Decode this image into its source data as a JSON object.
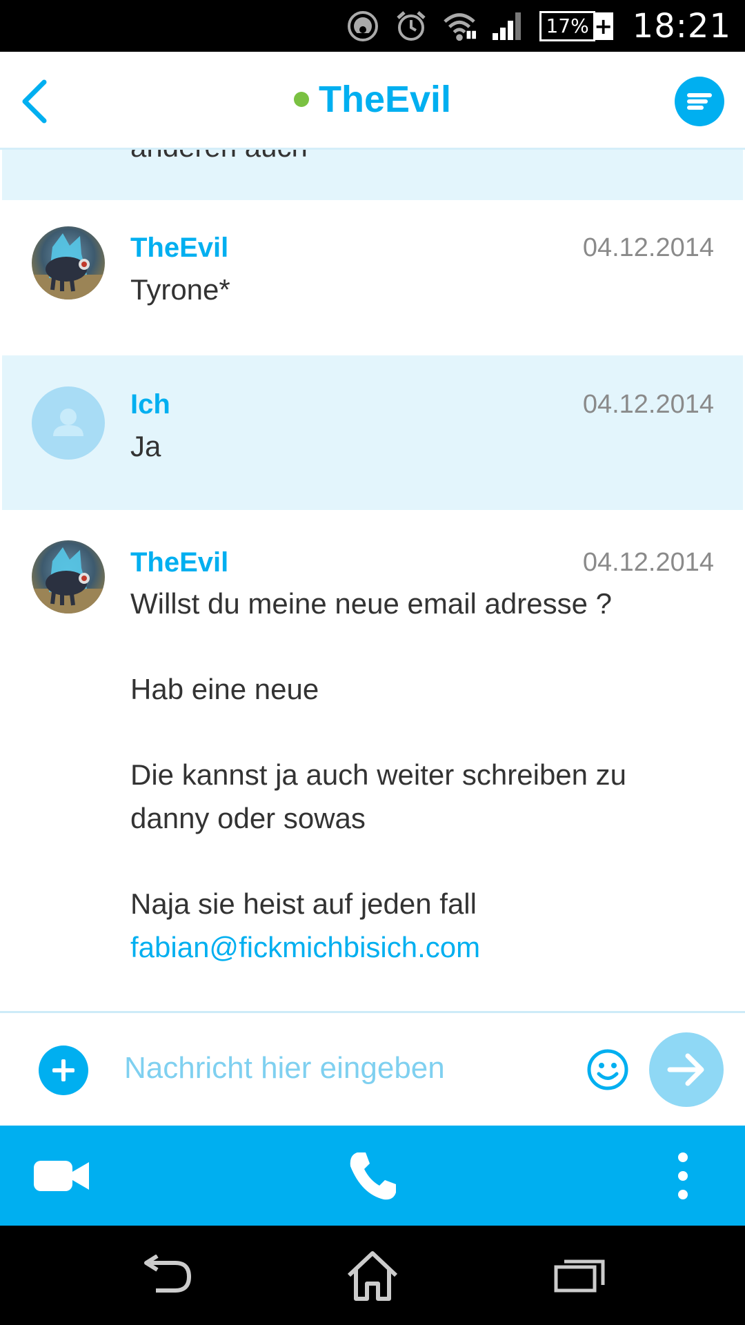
{
  "status_bar": {
    "battery_percent": "17%",
    "time": "18:21",
    "icons": [
      "speedometer-icon",
      "alarm-icon",
      "wifi-icon",
      "signal-icon",
      "battery-icon"
    ]
  },
  "header": {
    "title": "TheEvil",
    "presence": "online",
    "presence_color": "#7ac142",
    "accent_color": "#00aff0"
  },
  "chat": {
    "partial_message": "anderen auch",
    "messages": [
      {
        "sender": "TheEvil",
        "date": "04.12.2014",
        "text": "Tyrone*",
        "is_me": false
      },
      {
        "sender": "Ich",
        "date": "04.12.2014",
        "text": "Ja",
        "is_me": true
      },
      {
        "sender": "TheEvil",
        "date": "04.12.2014",
        "is_me": false,
        "lines": [
          "Willst du meine neue email adresse ?",
          "Hab eine neue",
          "Die kannst ja auch weiter schreiben zu",
          "danny oder sowas",
          "Naja sie heist auf jeden fall"
        ],
        "link": "fabian@fickmichbisich.com"
      }
    ]
  },
  "compose": {
    "placeholder": "Nachricht hier eingeben"
  },
  "action_bar": {
    "items": [
      "video-call-icon",
      "phone-call-icon",
      "more-options-icon"
    ]
  },
  "nav_bar": {
    "items": [
      "back-icon",
      "home-icon",
      "recents-icon"
    ]
  }
}
